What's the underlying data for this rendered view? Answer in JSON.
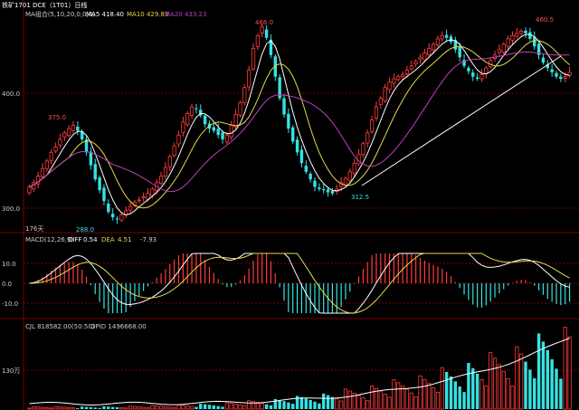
{
  "header": {
    "title": "铁矿1701 DCE（1T01）日线",
    "ma_label": "MA组合(5,10,20,0,0,0)",
    "ma5": "MA5 418.40",
    "ma10": "MA10 429.85",
    "ma20": "MA20 433.23"
  },
  "price_panel": {
    "y_labels": [
      "400.0",
      "300.0"
    ],
    "annotations": [
      "466.0",
      "460.5",
      "375.0",
      "312.5",
      "288.0"
    ],
    "days_label": "176天"
  },
  "macd_panel": {
    "label": "MACD(12,26,9)",
    "diff_label": "DIFF",
    "diff_value": "0.54",
    "dea_label": "DEA",
    "dea_value": "4.51",
    "macd_value": "-7.93",
    "y_labels": [
      "10.0",
      "0.0",
      "-10.0"
    ]
  },
  "volume_panel": {
    "cjl": "CJL 818582.00(50:50)",
    "opid": "OPID 1496668.00",
    "y_label": "130万"
  },
  "colors": {
    "up": "#ff3b3b",
    "down": "#36e2e2",
    "ma5": "#ffffff",
    "ma10": "#e6d84a",
    "ma20": "#c040c0",
    "grid": "#7a0000",
    "text_yellow": "#e6d84a"
  },
  "chart_data": {
    "type": "candlestick",
    "series": [
      {
        "name": "MA5",
        "value": 418.4
      },
      {
        "name": "MA10",
        "value": 429.85
      },
      {
        "name": "MA20",
        "value": 433.23
      }
    ],
    "ylim": [
      290,
      470
    ],
    "price_closes": [
      318,
      322,
      328,
      335,
      342,
      350,
      355,
      362,
      368,
      372,
      375,
      370,
      362,
      350,
      338,
      325,
      315,
      305,
      295,
      290,
      288,
      292,
      296,
      300,
      304,
      306,
      309,
      312,
      316,
      322,
      328,
      336,
      346,
      356,
      366,
      378,
      386,
      392,
      390,
      384,
      376,
      372,
      370,
      366,
      362,
      366,
      375,
      385,
      396,
      410,
      426,
      446,
      458,
      466,
      456,
      440,
      420,
      400,
      385,
      372,
      360,
      350,
      340,
      332,
      325,
      318,
      316,
      315,
      313,
      312,
      316,
      322,
      326,
      332,
      340,
      348,
      358,
      368,
      380,
      392,
      400,
      410,
      415,
      418,
      420,
      422,
      426,
      430,
      434,
      438,
      442,
      446,
      450,
      455,
      458,
      456,
      452,
      445,
      438,
      430,
      425,
      420,
      418,
      422,
      428,
      435,
      440,
      445,
      450,
      455,
      458,
      460,
      462,
      460,
      455,
      448,
      440,
      433,
      428,
      424,
      420,
      418,
      420,
      424
    ],
    "macd": {
      "ylim": [
        -15,
        15
      ],
      "diff_value": 0.54,
      "dea_value": 4.51,
      "macd_value": -7.93
    }
  }
}
